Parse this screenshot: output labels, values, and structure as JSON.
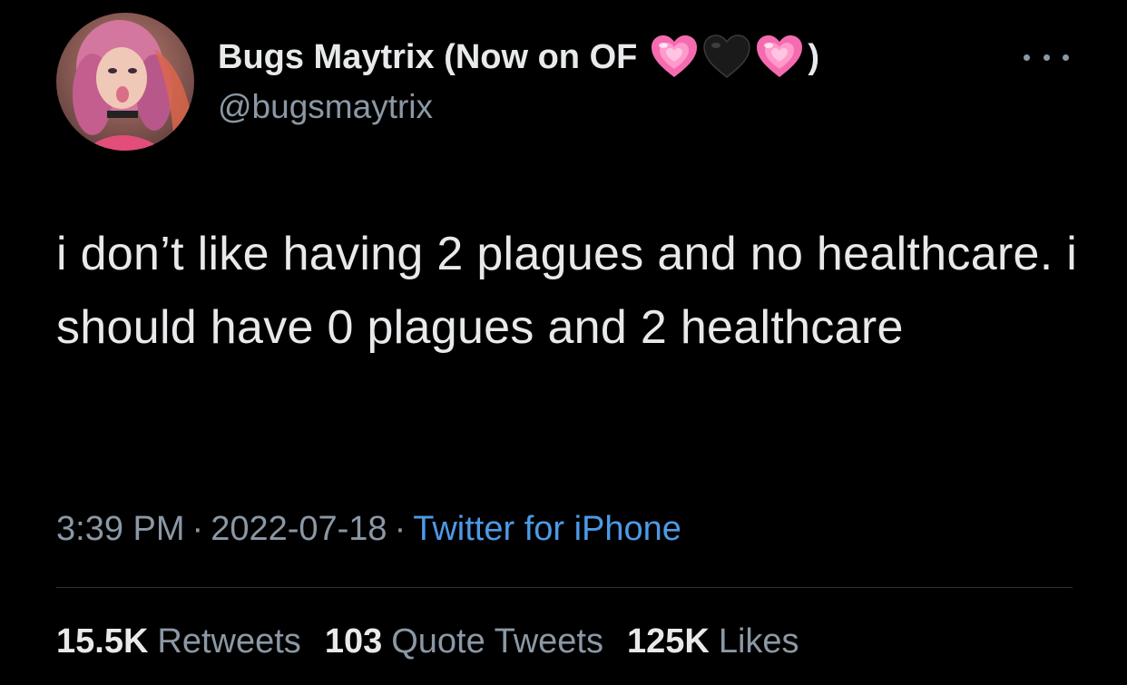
{
  "author": {
    "display_name": "Bugs Maytrix (Now on OF",
    "display_name_suffix": ")",
    "emoji": [
      "pink-heart",
      "black-heart",
      "pink-heart"
    ],
    "handle": "@bugsmaytrix"
  },
  "tweet": {
    "text": "i don’t like having 2 plagues and no healthcare. i should have 0 plagues and 2 healthcare"
  },
  "meta": {
    "time": "3:39 PM",
    "separator": "·",
    "date": "2022-07-18",
    "source": "Twitter for iPhone"
  },
  "stats": {
    "retweets_count": "15.5K",
    "retweets_label": "Retweets",
    "quotes_count": "103",
    "quotes_label": "Quote Tweets",
    "likes_count": "125K",
    "likes_label": "Likes"
  },
  "colors": {
    "background": "#000000",
    "text_primary": "#e7e9ea",
    "text_secondary": "#8b98a5",
    "link": "#4d9ae6",
    "pink_heart": "#f56bb0",
    "black_heart": "#1a1a1a"
  }
}
